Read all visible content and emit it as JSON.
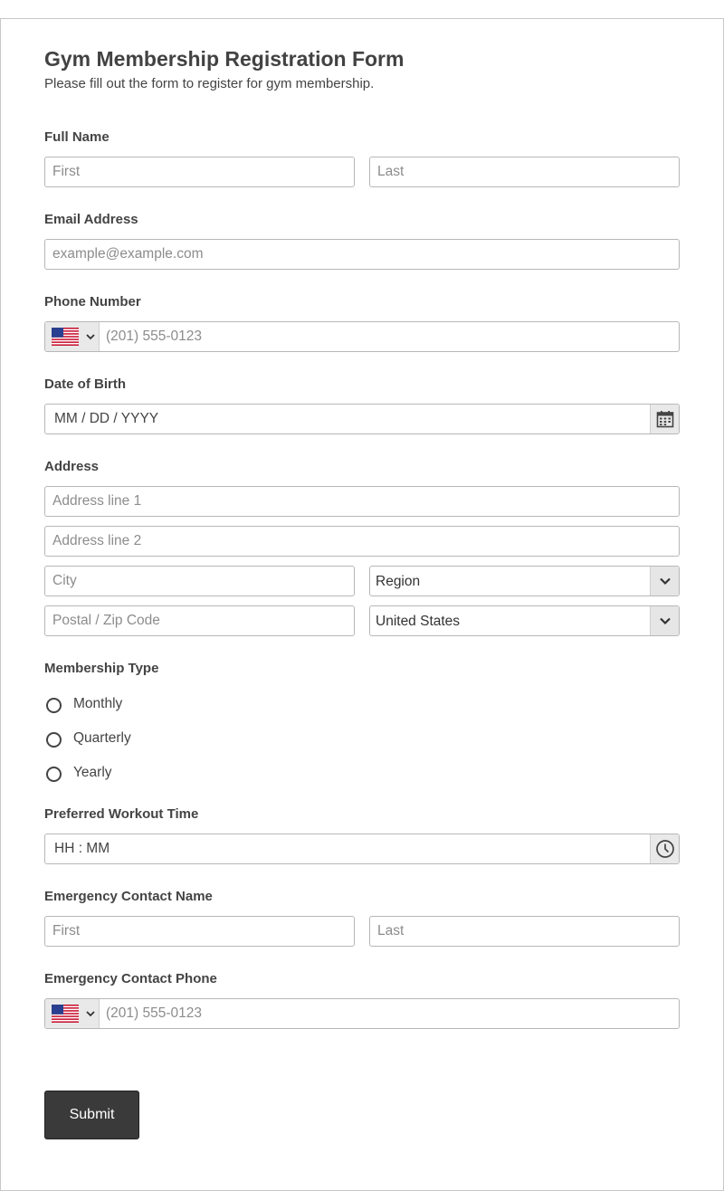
{
  "form": {
    "title": "Gym Membership Registration Form",
    "subtitle": "Please fill out the form to register for gym membership."
  },
  "full_name": {
    "label": "Full Name",
    "first_placeholder": "First",
    "last_placeholder": "Last"
  },
  "email": {
    "label": "Email Address",
    "placeholder": "example@example.com"
  },
  "phone": {
    "label": "Phone Number",
    "placeholder": "(201) 555-0123",
    "country_icon": "us-flag-icon"
  },
  "dob": {
    "label": "Date of Birth",
    "placeholder": "MM / DD / YYYY",
    "icon": "calendar-icon"
  },
  "address": {
    "label": "Address",
    "line1_placeholder": "Address line 1",
    "line2_placeholder": "Address line 2",
    "city_placeholder": "City",
    "region_value": "Region",
    "postal_placeholder": "Postal / Zip Code",
    "country_value": "United States"
  },
  "membership": {
    "label": "Membership Type",
    "options": [
      "Monthly",
      "Quarterly",
      "Yearly"
    ]
  },
  "workout_time": {
    "label": "Preferred Workout Time",
    "placeholder": "HH : MM",
    "icon": "clock-icon"
  },
  "emergency_name": {
    "label": "Emergency Contact Name",
    "first_placeholder": "First",
    "last_placeholder": "Last"
  },
  "emergency_phone": {
    "label": "Emergency Contact Phone",
    "placeholder": "(201) 555-0123",
    "country_icon": "us-flag-icon"
  },
  "submit": {
    "label": "Submit"
  },
  "colors": {
    "button_bg": "#3a3a3a",
    "border": "#b7b7b7",
    "text": "#444444"
  }
}
